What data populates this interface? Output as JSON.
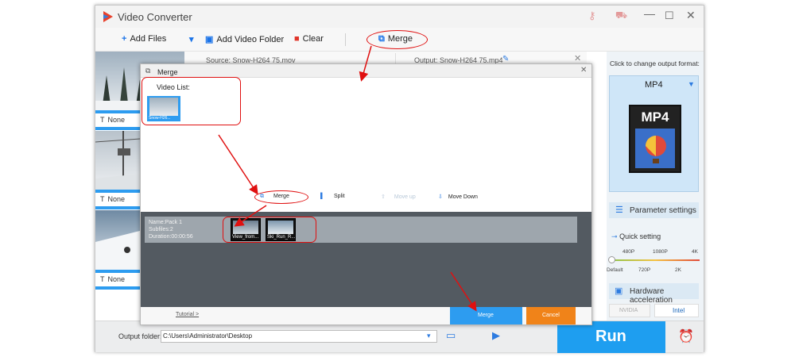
{
  "app": {
    "title": "Video Converter"
  },
  "toolbar": {
    "add_files": "Add Files",
    "add_video_folder": "Add Video Folder",
    "clear": "Clear",
    "merge": "Merge"
  },
  "file_row": {
    "source": "Source: Snow-H264 75.mov",
    "output": "Output: Snow-H264 75.mp4"
  },
  "thumbs": [
    {
      "label": "None"
    },
    {
      "label": "None"
    },
    {
      "label": "None"
    }
  ],
  "right_panel": {
    "change_format_label": "Click to change output format:",
    "format": "MP4",
    "format_icon_text": "MP4",
    "parameter_settings": "Parameter settings",
    "quick_setting": "Quick setting",
    "quality_top": [
      "480P",
      "1080P",
      "4K"
    ],
    "quality_bottom": [
      "Default",
      "720P",
      "2K"
    ],
    "hardware_acceleration": "Hardware acceleration",
    "nvidia": "NVIDIA",
    "intel": "Intel"
  },
  "bottom": {
    "output_folder_label": "Output folder:",
    "output_path": "C:\\Users\\Administrator\\Desktop",
    "run": "Run"
  },
  "merge_dialog": {
    "title": "Merge",
    "video_list_label": "Video List:",
    "video_thumb_label": "Snow-H26...",
    "buttons": {
      "merge": "Merge",
      "split": "Split",
      "move_up": "Move up",
      "move_down": "Move Down"
    },
    "pack": {
      "name": "Name:Pack 1",
      "subfiles": "Subfiles:2",
      "duration": "Duration:00:00:56"
    },
    "pack_clips": [
      "View_from...",
      "Ski_Run_R..."
    ],
    "tutorial": "Tutorial >",
    "merge_button": "Merge",
    "cancel_button": "Cancel"
  },
  "colors": {
    "accent_blue": "#2d9cf0",
    "run_blue": "#1e9ef0",
    "cancel_orange": "#f08319",
    "annotation_red": "#e01010"
  }
}
